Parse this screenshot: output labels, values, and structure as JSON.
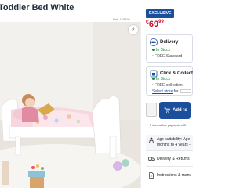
{
  "product": {
    "title": "Toddler Bed White",
    "ref": "Ref: 165496"
  },
  "gallery": {
    "zoom_icon": "magnify-icon"
  },
  "purchase": {
    "badge": "EXCLUSIVE",
    "price_currency": "€",
    "price_whole": "69",
    "price_cents": "99",
    "delivery": {
      "title": "Delivery",
      "stock": "In Stock",
      "free": "FREE Standard"
    },
    "collect": {
      "title": "Click & Collect",
      "stock": "In Stock",
      "free": "FREE collection",
      "link": "Select store",
      "link_suffix": "for"
    },
    "add_label": "Add to",
    "installments": "3 interest-free payments of €"
  },
  "info_rows": {
    "age_line1": "Age suitability: Age",
    "age_line2": "months to 4 years -",
    "delivery_returns": "Delivery & Returns",
    "instructions": "Instructions & manu"
  },
  "colors": {
    "brand_blue": "#1b4f9c",
    "price_red": "#c8102e",
    "stock_green": "#1a8a3a"
  }
}
